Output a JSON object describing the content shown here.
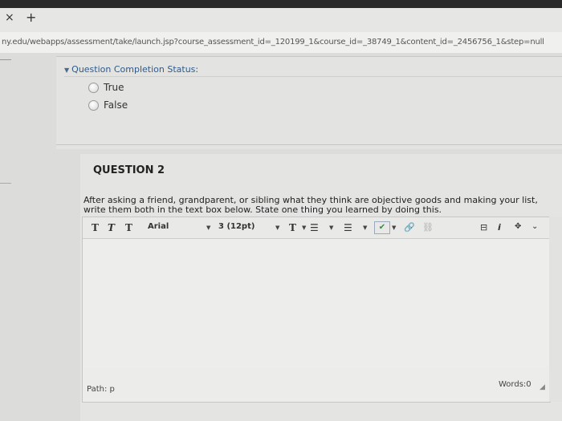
{
  "browser": {
    "url": "ny.edu/webapps/assessment/take/launch.jsp?course_assessment_id=_120199_1&course_id=_38749_1&content_id=_2456756_1&step=null",
    "tab_close": "×",
    "tab_new": "+"
  },
  "status": {
    "label": "Question Completion Status:",
    "options": [
      "True",
      "False"
    ]
  },
  "question": {
    "title": "QUESTION 2",
    "prompt": "After asking a friend, grandparent, or sibling what they think are objective goods and making your list, write them both in the text box below. State one thing you learned by doing this."
  },
  "editor": {
    "font": "Arial",
    "size": "3 (12pt)",
    "path_label": "Path: p",
    "words_label": "Words:0"
  }
}
